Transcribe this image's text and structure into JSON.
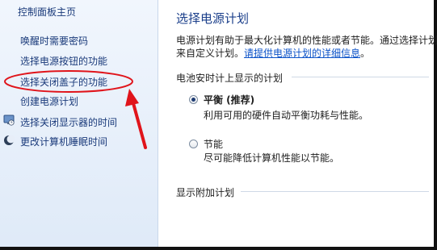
{
  "sidebar": {
    "items": [
      {
        "label": "控制面板主页"
      },
      {
        "label": "唤醒时需要密码"
      },
      {
        "label": "选择电源按钮的功能"
      },
      {
        "label": "选择关闭盖子的功能"
      },
      {
        "label": "创建电源计划"
      },
      {
        "label": "选择关闭显示器的时间"
      },
      {
        "label": "更改计算机睡眠时间"
      }
    ]
  },
  "main": {
    "title": "选择电源计划",
    "description_line1": "电源计划有助于最大化计算机的性能或者节能。通过选择计划",
    "description_line2_prefix": "来自定义计划。",
    "description_link": "请提供电源计划的详细信息",
    "description_line2_suffix": "。",
    "battery_section_label": "电池安时计上显示的计划",
    "plans": [
      {
        "name": "平衡 (推荐)",
        "description": "利用可用的硬件自动平衡功耗与性能。",
        "selected": true
      },
      {
        "name": "节能",
        "description": "尽可能降低计算机性能以节能。",
        "selected": false
      }
    ],
    "additional_section_label": "显示附加计划"
  },
  "colors": {
    "link": "#1a3a7a",
    "title": "#1a3e8a",
    "annotation": "#e0141b"
  },
  "icons": {
    "display_item_icon": "monitor-clock-icon",
    "sleep_item_icon": "moon-icon"
  }
}
